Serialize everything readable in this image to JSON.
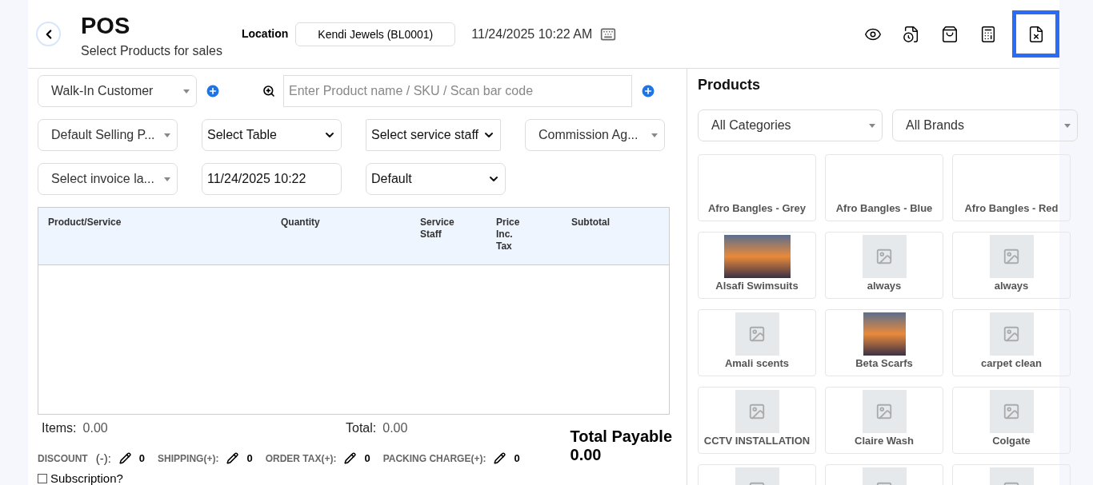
{
  "header": {
    "title": "POS",
    "subtitle": "Select Products for sales",
    "location_label": "Location",
    "location": "Kendi Jewels (BL0001)",
    "datetime": "11/24/2025 10:22 AM",
    "actions": [
      {
        "kind": "eye",
        "selected": false
      },
      {
        "kind": "receipt-clock",
        "selected": false
      },
      {
        "kind": "bag-search",
        "selected": false
      },
      {
        "kind": "register",
        "selected": false
      },
      {
        "kind": "receipt-close",
        "selected": true
      }
    ]
  },
  "form": {
    "customer": "Walk-In Customer",
    "search_placeholder": "Enter Product name / SKU / Scan bar code",
    "row2": [
      {
        "kind": "select2",
        "value": "Default Selling P..."
      },
      {
        "kind": "native",
        "value": "Select Table"
      },
      {
        "kind": "native",
        "value": "Select service staff"
      },
      {
        "kind": "select2",
        "value": "Commission Ag..."
      }
    ],
    "row3": [
      {
        "kind": "select2",
        "value": "Select invoice la..."
      },
      {
        "kind": "input",
        "value": "11/24/2025 10:22"
      },
      {
        "kind": "native",
        "value": "Default"
      }
    ]
  },
  "table": {
    "columns": [
      "Product/Service",
      "Quantity",
      "Service\nStaff",
      "Price\nInc.\nTax",
      "Subtotal"
    ]
  },
  "totals": {
    "items_label": "Items:",
    "items": "0.00",
    "total_label": "Total:",
    "total": "0.00"
  },
  "charges": [
    {
      "label": "DISCOUNT",
      "sign": "(-):",
      "value": "0"
    },
    {
      "label": "SHIPPING(+):",
      "value": "0"
    },
    {
      "label": "ORDER TAX(+):",
      "value": "0"
    },
    {
      "label": "PACKING CHARGE(+):",
      "value": "0"
    }
  ],
  "subscription": {
    "label": "Subscription?",
    "checked": false
  },
  "payable": {
    "label": "Total Payable",
    "value": "0.00"
  },
  "products": {
    "title": "Products",
    "category": "All Categories",
    "brand": "All Brands",
    "items": [
      {
        "name": "Afro Bangles - Grey",
        "kind": "blank"
      },
      {
        "name": "Afro Bangles - Blue",
        "kind": "blank"
      },
      {
        "name": "Afro Bangles - Red",
        "kind": "blank"
      },
      {
        "name": "Alsafi Swimsuits",
        "kind": "photo"
      },
      {
        "name": "always",
        "kind": "placeholder"
      },
      {
        "name": "always",
        "kind": "placeholder"
      },
      {
        "name": "Amali scents",
        "kind": "placeholder"
      },
      {
        "name": "Beta Scarfs",
        "kind": "photo"
      },
      {
        "name": "carpet clean",
        "kind": "placeholder"
      },
      {
        "name": "CCTV INSTALLATION",
        "kind": "placeholder"
      },
      {
        "name": "Claire Wash",
        "kind": "placeholder"
      },
      {
        "name": "Colgate",
        "kind": "placeholder"
      },
      {
        "kind": "placeholder"
      },
      {
        "kind": "placeholder"
      },
      {
        "kind": "placeholder"
      }
    ]
  }
}
